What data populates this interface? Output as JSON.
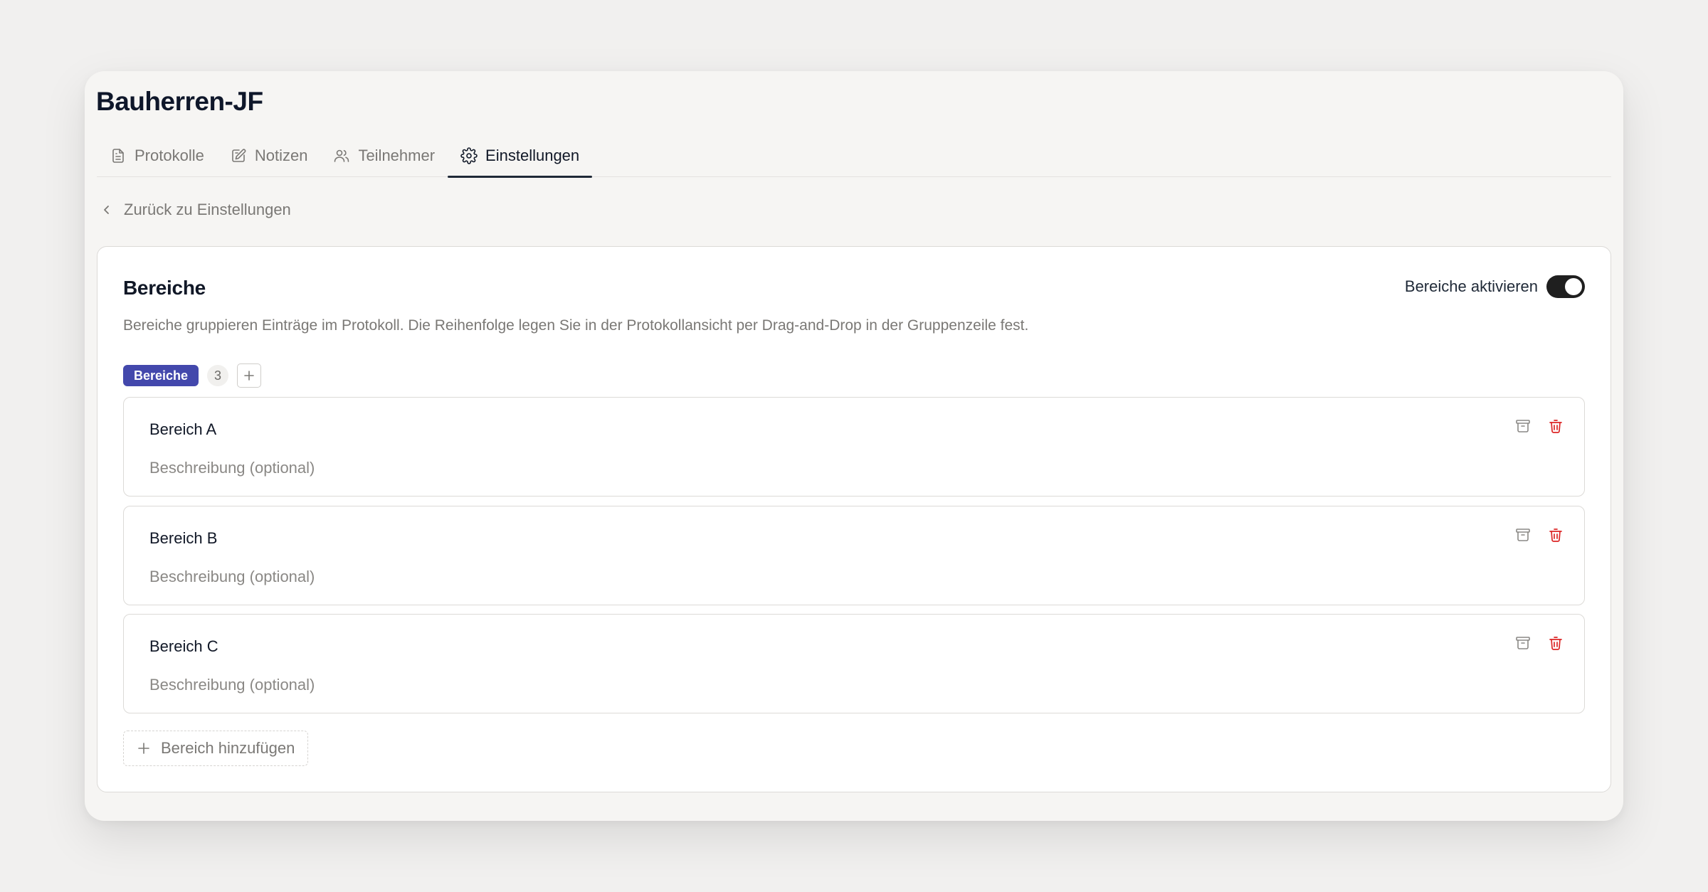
{
  "project": {
    "title": "Bauherren-JF"
  },
  "tabs": [
    {
      "label": "Protokolle",
      "icon": "document-icon",
      "active": false
    },
    {
      "label": "Notizen",
      "icon": "note-edit-icon",
      "active": false
    },
    {
      "label": "Teilnehmer",
      "icon": "users-icon",
      "active": false
    },
    {
      "label": "Einstellungen",
      "icon": "gear-icon",
      "active": true
    }
  ],
  "back_link": {
    "label": "Zurück zu Einstellungen",
    "icon": "chevron-left-icon"
  },
  "section": {
    "title": "Bereiche",
    "toggle_label": "Bereiche aktivieren",
    "toggle_on": true,
    "description": "Bereiche gruppieren Einträge im Protokoll. Die Reihenfolge legen Sie in der Protokollansicht per Drag-and-Drop in der Gruppenzeile fest.",
    "chip_label": "Bereiche",
    "count": "3",
    "add_label": "Bereich hinzufügen"
  },
  "items": [
    {
      "name": "Bereich A",
      "description_placeholder": "Beschreibung (optional)"
    },
    {
      "name": "Bereich B",
      "description_placeholder": "Beschreibung (optional)"
    },
    {
      "name": "Bereich C",
      "description_placeholder": "Beschreibung (optional)"
    }
  ],
  "colors": {
    "accent": "#4348ac",
    "danger": "#dc2626",
    "toggle": "#1f1f1f",
    "background": "#f1f0ef"
  }
}
